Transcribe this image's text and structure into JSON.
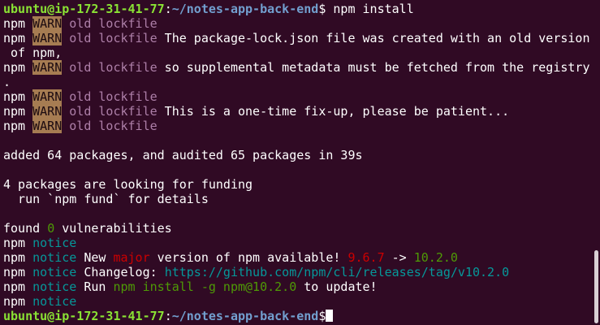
{
  "terminal": {
    "prompt_user": "ubuntu@ip-172-31-41-77",
    "prompt_sep": ":",
    "prompt_path": "~/notes-app-back-end",
    "prompt_symbol": "$",
    "command": " npm install",
    "npm": "npm",
    "warn": "WARN",
    "old_lockfile": "old lockfile",
    "warn_msgs": [
      " The package-lock.json file was created with an old version",
      " so supplemental metadata must be fetched from the registry",
      " This is a one-time fix-up, please be patient..."
    ],
    "wrap_of_npm": " of npm,",
    "wrap_dot": ".",
    "added": "added 64 packages, and audited 65 packages in 39s",
    "funding_1": "4 packages are looking for funding",
    "funding_2": "  run `npm fund` for details",
    "found_pre": "found ",
    "found_count": "0",
    "found_post": " vulnerabilities",
    "notice": "notice",
    "new_pre": " New ",
    "major": "major",
    "new_mid": " version of npm available! ",
    "old_version": "9.6.7",
    "arrow": " -> ",
    "new_version": "10.2.0",
    "changelog_label": " Changelog: ",
    "changelog_url": "https://github.com/npm/cli/releases/tag/v10.2.0",
    "run_label": " Run ",
    "run_cmd": "npm install -g npm@10.2.0",
    "run_post": " to update!"
  },
  "colors": {
    "background": "#300a24",
    "prompt_user": "#8ae234",
    "prompt_path": "#729fcf",
    "warn_bg": "#a67c52",
    "magenta": "#ad7fa8",
    "cyan": "#06989a",
    "red": "#cc0000",
    "green": "#4e9a06"
  }
}
